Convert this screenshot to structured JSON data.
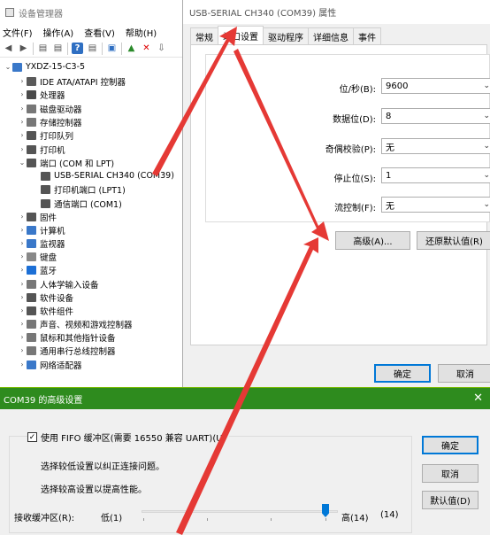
{
  "devmgr": {
    "title": "设备管理器",
    "menu": [
      "文件(F)",
      "操作(A)",
      "查看(V)",
      "帮助(H)"
    ],
    "tree": [
      {
        "label": "YXDZ-15-C3-5",
        "level": 0,
        "chev": "⌄",
        "color": "#3a78c9"
      },
      {
        "label": "IDE ATA/ATAPI 控制器",
        "level": 1,
        "chev": "›",
        "color": "#5a5a5a"
      },
      {
        "label": "处理器",
        "level": 1,
        "chev": "›",
        "color": "#4a4a4a"
      },
      {
        "label": "磁盘驱动器",
        "level": 1,
        "chev": "›",
        "color": "#777"
      },
      {
        "label": "存储控制器",
        "level": 1,
        "chev": "›",
        "color": "#777"
      },
      {
        "label": "打印队列",
        "level": 1,
        "chev": "›",
        "color": "#555"
      },
      {
        "label": "打印机",
        "level": 1,
        "chev": "›",
        "color": "#555"
      },
      {
        "label": "端口 (COM 和 LPT)",
        "level": 1,
        "chev": "⌄",
        "color": "#555"
      },
      {
        "label": "USB-SERIAL CH340 (COM39)",
        "level": 2,
        "chev": "",
        "color": "#555"
      },
      {
        "label": "打印机端口 (LPT1)",
        "level": 2,
        "chev": "",
        "color": "#555"
      },
      {
        "label": "通信端口 (COM1)",
        "level": 2,
        "chev": "",
        "color": "#555"
      },
      {
        "label": "固件",
        "level": 1,
        "chev": "›",
        "color": "#555"
      },
      {
        "label": "计算机",
        "level": 1,
        "chev": "›",
        "color": "#3a78c9"
      },
      {
        "label": "监视器",
        "level": 1,
        "chev": "›",
        "color": "#3a78c9"
      },
      {
        "label": "键盘",
        "level": 1,
        "chev": "›",
        "color": "#888"
      },
      {
        "label": "蓝牙",
        "level": 1,
        "chev": "›",
        "color": "#1c6fd6"
      },
      {
        "label": "人体学输入设备",
        "level": 1,
        "chev": "›",
        "color": "#777"
      },
      {
        "label": "软件设备",
        "level": 1,
        "chev": "›",
        "color": "#555"
      },
      {
        "label": "软件组件",
        "level": 1,
        "chev": "›",
        "color": "#555"
      },
      {
        "label": "声音、视频和游戏控制器",
        "level": 1,
        "chev": "›",
        "color": "#777"
      },
      {
        "label": "鼠标和其他指针设备",
        "level": 1,
        "chev": "›",
        "color": "#777"
      },
      {
        "label": "通用串行总线控制器",
        "level": 1,
        "chev": "›",
        "color": "#777"
      },
      {
        "label": "网络适配器",
        "level": 1,
        "chev": "›",
        "color": "#3a78c9"
      }
    ]
  },
  "props": {
    "title": "USB-SERIAL CH340 (COM39) 属性",
    "tabs": [
      "常规",
      "端口设置",
      "驱动程序",
      "详细信息",
      "事件"
    ],
    "fields": [
      {
        "label": "位/秒(B):",
        "value": "9600"
      },
      {
        "label": "数据位(D):",
        "value": "8"
      },
      {
        "label": "奇偶校验(P):",
        "value": "无"
      },
      {
        "label": "停止位(S):",
        "value": "1"
      },
      {
        "label": "流控制(F):",
        "value": "无"
      }
    ],
    "advanced_button": "高级(A)...",
    "restore_button": "还原默认值(R)",
    "ok_button": "确定",
    "cancel_button": "取消"
  },
  "adv": {
    "title": "COM39 的高级设置",
    "fifo_label": "使用 FIFO 缓冲区(需要 16550 兼容 UART)(U)",
    "hint_low": "选择较低设置以纠正连接问题。",
    "hint_high": "选择较高设置以提高性能。",
    "receive_label": "接收缓冲区(R):",
    "low_label": "低(1)",
    "high_label": "高(14)",
    "current_value": "(14)",
    "ok_button": "确定",
    "cancel_button": "取消",
    "default_button": "默认值(D)",
    "close_glyph": "✕"
  },
  "icons": {
    "checkmark": "✓"
  }
}
